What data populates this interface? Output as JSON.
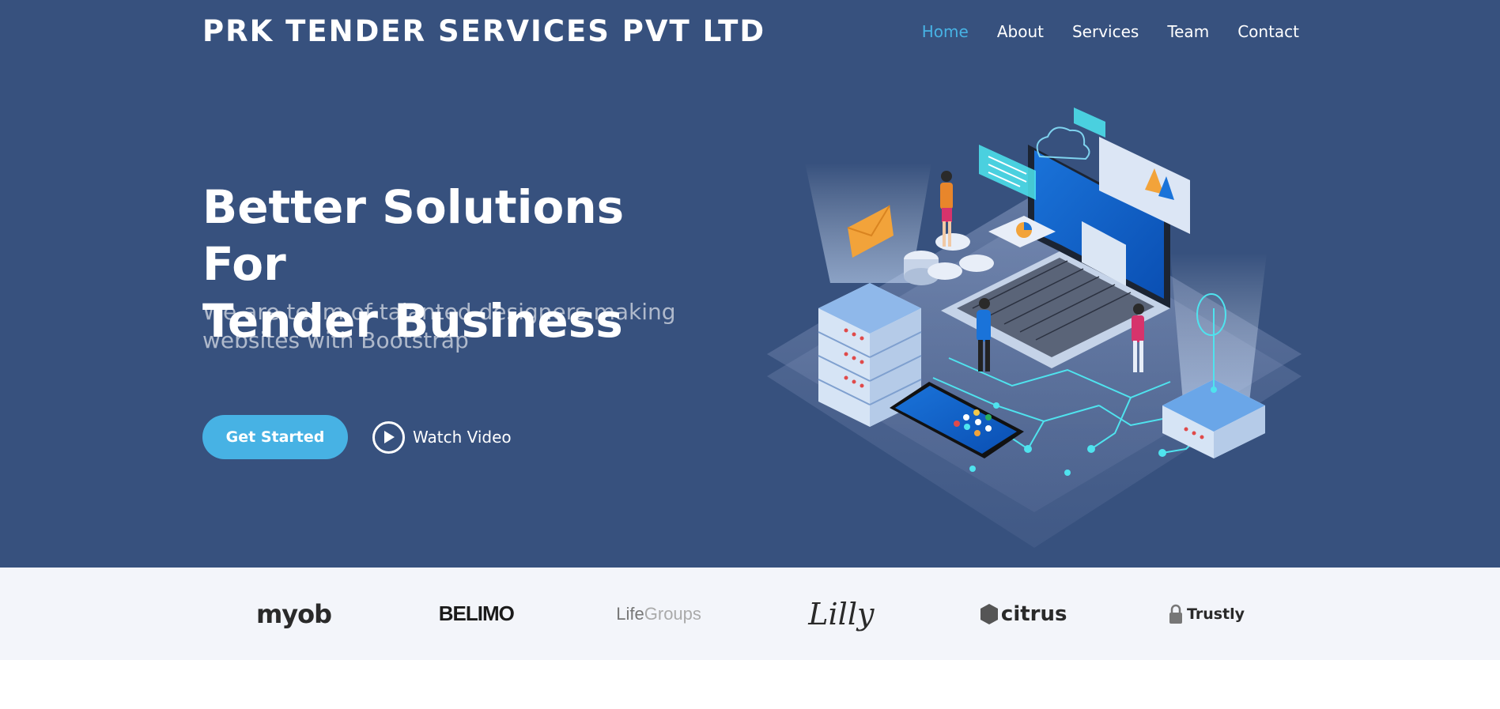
{
  "header": {
    "brand": "PRK TENDER SERVICES PVT LTD",
    "nav": [
      {
        "label": "Home",
        "active": true
      },
      {
        "label": "About",
        "active": false
      },
      {
        "label": "Services",
        "active": false
      },
      {
        "label": "Team",
        "active": false
      },
      {
        "label": "Contact",
        "active": false
      }
    ]
  },
  "hero": {
    "title_line1": "Better Solutions For",
    "title_line2": "Tender Business",
    "subtitle": "We are team of talanted designers making websites with Bootstrap",
    "cta_label": "Get Started",
    "video_label": "Watch Video"
  },
  "clients": {
    "logos": [
      {
        "name": "myob",
        "icon": "myob-logo"
      },
      {
        "name": "BELIMO",
        "icon": "belimo-logo"
      },
      {
        "name_a": "Life",
        "name_b": "Groups",
        "icon": "lifegroups-logo"
      },
      {
        "name": "Lilly",
        "icon": "lilly-logo"
      },
      {
        "name": "citrus",
        "icon": "citrus-logo"
      },
      {
        "name": "Trustly",
        "icon": "trustly-logo"
      }
    ]
  },
  "colors": {
    "hero_bg": "#37517e",
    "accent": "#47b2e4",
    "clients_bg": "#f3f5fa"
  }
}
